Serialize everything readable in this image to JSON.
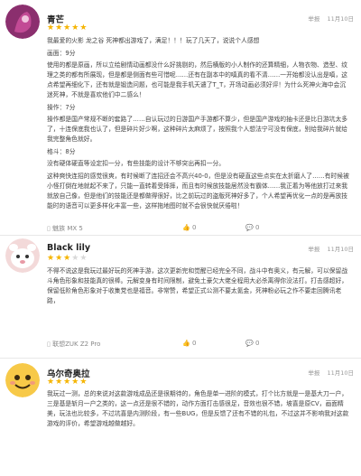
{
  "reviews": [
    {
      "username": "青芒",
      "report": "举报",
      "date": "11月10日",
      "stars": 5,
      "paragraphs": [
        "我最爱的火影 龙之谷 死神都出游戏了，满足！！！玩了几天了，说说个人感想",
        "画面：9分",
        "使用的都是原画，所以立绘剧情动画都没什么好挑剔的，然后横版的小人制作的还算精细，人物衣物、造型、纹理之类的都有所展现，但是都是侧面有些可惜呢……还有在副本中的嗔真的看不清……一开始都没认出是嗔，这点希望再细化下，还有就是锻造问题，也可能是我手机天谴了T_T，开场动画必须好评！为什么死神火海中会沉迷死神，不就是喜欢他们中二感么！",
        "操作：7分",
        "操作都是国产常规不断的套路了……自认玩过的日游国产手游都不算少，但是国产游戏的抽卡还是比日游坑太多了，十连保底我也认了，但是碎片好少啊，这种碎片太麻烦了，按照我个人想法宁可没有保底，别给我碎片就给我完整角色就好。",
        "格斗：8分",
        "没有硬体硬直等设定扣一分，有些技能的设计不够突出再扣一分。",
        "这种爽快连招的感觉很爽，有时候断了连招还会不高兴40-0，但是没有硬直这些点实在太折磨人了……有时候被小怪打倒在地就起不来了，只能一直转着受摔摔，而且有时候放技能居然没有霸体……我正着为等他放打过来我就放自己像，但是他们的技能还是都做得很好，比之前玩过的盗版死神好多了，个人希望再优化一点的是再放技能时的语音可以更多样化丰富一些，这样拖地图时就不会很快就厌倦啦！"
      ],
      "device": "魅族 MX 5",
      "likes": "0",
      "replies": "0"
    },
    {
      "username": "Black lily",
      "report": "举报",
      "date": "11月10日",
      "stars": 3,
      "paragraphs": [
        "不得不说这是我玩过最好玩的死神手游，这次更新完和觉醒已经完全不同，战斗中有奥义，有元解，可以保留战斗角色形象和技能真的很棒。元解变身有时间限制，避免土豪欠大佬全程用大必杀离得你没法打。打击感超好，保留低阶角色形象对于收集党也是福音。非常赞，希望正式公测不要太氪金，死神粉必玩之作不要走回腾讯老路，"
      ],
      "device": "联想ZUK Z2 Pro",
      "likes": "0",
      "replies": "0"
    },
    {
      "username": "乌尔奇奥拉",
      "report": "举报",
      "date": "11月10日",
      "stars": 5,
      "paragraphs": [
        "我玩过一测，总的来说对这款游戏成品还是很期待的，角色是单一进阶的模式，打个比方就是一是基大刀一户，三是基是斩月一户之类的，这一点还是很不错的，动作方面打击感很足，音效也很不错，坡喜是原CV，画面精美，玩法也比较多，不过坑喜是内测阶段，有一些BUG，但是反馈了还有不错的礼包，不过这并不影响我对这款游戏的评价，希望游戏越做越好。"
      ]
    }
  ],
  "colors": {
    "star_on": "#f5b400",
    "star_off": "#d8d8d8",
    "text": "#444444",
    "meta": "#999999"
  }
}
